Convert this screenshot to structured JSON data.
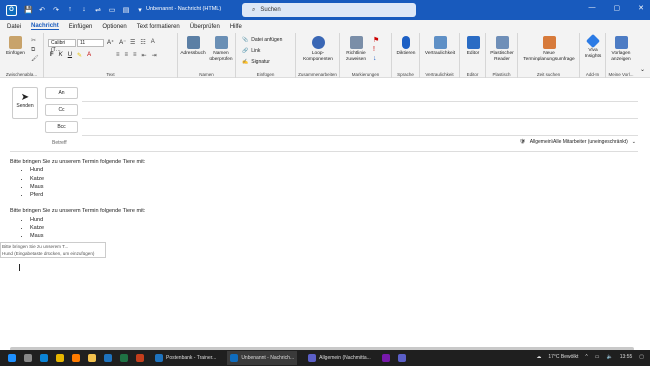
{
  "window": {
    "title": "Unbenannt - Nachricht (HTML)",
    "search_placeholder": "Suchen",
    "controls": [
      "—",
      "▢",
      "✕"
    ]
  },
  "quick_access": [
    "💾",
    "↶",
    "↷",
    "↑",
    "↓",
    "⇌",
    "▭",
    "▤",
    "▾"
  ],
  "menu": [
    "Datei",
    "Nachricht",
    "Einfügen",
    "Optionen",
    "Text formatieren",
    "Überprüfen",
    "Hilfe"
  ],
  "ribbon": {
    "clipboard": {
      "paste": "Einfügen",
      "label": "Zwischenabla..."
    },
    "text": {
      "font": "Calibri (T…",
      "size": "11",
      "label": "Text",
      "bold": "F",
      "italic": "K",
      "underline": "U"
    },
    "names": {
      "address": "Adressbuch",
      "check": "Namen überprüfen",
      "label": "Namen"
    },
    "include": {
      "attach": "Datei anfügen",
      "link": "Link",
      "signature": "Signatur",
      "label": "Einfügen"
    },
    "loop": {
      "btn": "Loop-Komponenten",
      "label": "Zusammenarbeiten"
    },
    "tags": {
      "policy": "Richtlinie zuweisen",
      "label": "Markierungen"
    },
    "voice": {
      "dictate": "Diktieren",
      "label": "Sprache"
    },
    "sensitivity": {
      "btn": "Vertraulichkeit",
      "label": "Vertraulichkeit"
    },
    "editor": {
      "btn": "Editor",
      "label": "Editor"
    },
    "reader": {
      "btn": "Plastischer Reader",
      "label": "Plastisch"
    },
    "time": {
      "btn": "Neue Terminplanungsumfrage",
      "label": "Zeit suchen"
    },
    "addin": {
      "btn": "Viva Insights",
      "label": "Add-In"
    },
    "templates": {
      "btn": "Vorlagen anzeigen",
      "label": "Meine Vorl..."
    }
  },
  "compose": {
    "send": "Senden",
    "to": "An",
    "cc": "Cc",
    "bcc": "Bcc",
    "subject": "Betreff",
    "sensitivity_label": "Allgemein\\Alle Mitarbeiter (uneingeschränkt)",
    "paragraph1": "Bitte bringen Sie zu unserem Termin folgende Tiere mit:",
    "list1": [
      "Hund",
      "Katze",
      "Maus",
      "Pferd"
    ],
    "paragraph2": "Bitte bringen Sie zu unserem Termin folgende Tiere mit:",
    "list2": [
      "Hund",
      "Katze",
      "Maus"
    ],
    "typing": "Bitt",
    "autocomplete_line1": "Bitte bringen Sie zu unserem T...",
    "autocomplete_line2": "Hund (Eingabetaste drücken, um einzufügen)"
  },
  "taskbar": {
    "tasks": [
      "Postenbank - Trainer...",
      "Unbenannt - Nachrich...",
      "Allgemein (Nachmitta..."
    ],
    "weather": "17°C Bewölkt",
    "time": "13:55"
  }
}
